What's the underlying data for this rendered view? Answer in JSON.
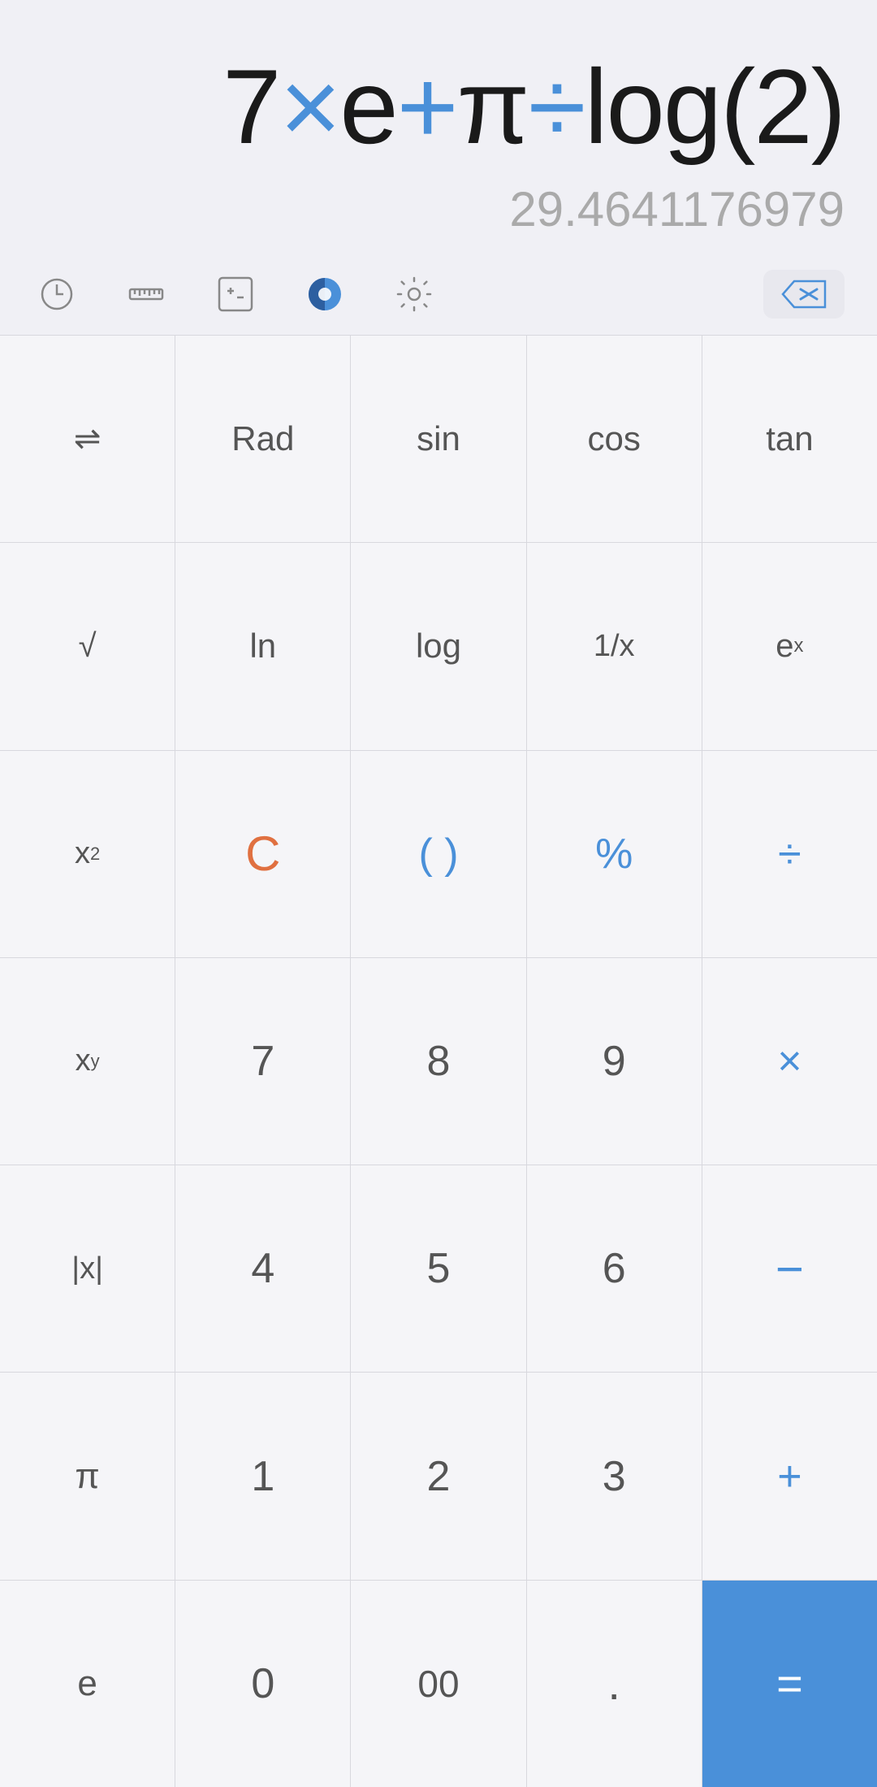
{
  "display": {
    "expression": {
      "parts": [
        {
          "text": "7",
          "style": "normal"
        },
        {
          "text": "×",
          "style": "blue"
        },
        {
          "text": "e",
          "style": "normal"
        },
        {
          "text": "+",
          "style": "blue"
        },
        {
          "text": "π",
          "style": "normal"
        },
        {
          "text": "÷",
          "style": "blue"
        },
        {
          "text": "log(2)",
          "style": "normal"
        }
      ],
      "full": "7×e+π÷log(2)"
    },
    "result": "29.4641176979"
  },
  "toolbar": {
    "history_label": "history",
    "ruler_label": "ruler",
    "plusminus_label": "plusminus",
    "theme_label": "theme",
    "settings_label": "settings",
    "backspace_label": "⌫"
  },
  "keypad": {
    "rows": [
      [
        {
          "label": "⇌",
          "style": "normal",
          "name": "swap"
        },
        {
          "label": "Rad",
          "style": "normal",
          "name": "rad"
        },
        {
          "label": "sin",
          "style": "normal",
          "name": "sin"
        },
        {
          "label": "cos",
          "style": "normal",
          "name": "cos"
        },
        {
          "label": "tan",
          "style": "normal",
          "name": "tan"
        }
      ],
      [
        {
          "label": "√",
          "style": "normal",
          "name": "sqrt"
        },
        {
          "label": "ln",
          "style": "normal",
          "name": "ln"
        },
        {
          "label": "log",
          "style": "normal",
          "name": "log"
        },
        {
          "label": "1/x",
          "style": "normal",
          "name": "reciprocal"
        },
        {
          "label": "eˣ",
          "style": "normal",
          "name": "exp"
        }
      ],
      [
        {
          "label": "x²",
          "style": "normal",
          "name": "square"
        },
        {
          "label": "C",
          "style": "orange",
          "name": "clear"
        },
        {
          "label": "( )",
          "style": "blue",
          "name": "parens"
        },
        {
          "label": "%",
          "style": "blue",
          "name": "percent"
        },
        {
          "label": "÷",
          "style": "blue",
          "name": "divide"
        }
      ],
      [
        {
          "label": "xʸ",
          "style": "normal",
          "name": "power"
        },
        {
          "label": "7",
          "style": "normal",
          "name": "seven"
        },
        {
          "label": "8",
          "style": "normal",
          "name": "eight"
        },
        {
          "label": "9",
          "style": "normal",
          "name": "nine"
        },
        {
          "label": "×",
          "style": "blue",
          "name": "multiply"
        }
      ],
      [
        {
          "label": "|x|",
          "style": "normal",
          "name": "abs"
        },
        {
          "label": "4",
          "style": "normal",
          "name": "four"
        },
        {
          "label": "5",
          "style": "normal",
          "name": "five"
        },
        {
          "label": "6",
          "style": "normal",
          "name": "six"
        },
        {
          "label": "−",
          "style": "blue",
          "name": "subtract"
        }
      ],
      [
        {
          "label": "π",
          "style": "normal",
          "name": "pi"
        },
        {
          "label": "1",
          "style": "normal",
          "name": "one"
        },
        {
          "label": "2",
          "style": "normal",
          "name": "two"
        },
        {
          "label": "3",
          "style": "normal",
          "name": "three"
        },
        {
          "label": "+",
          "style": "blue",
          "name": "add"
        }
      ],
      [
        {
          "label": "e",
          "style": "normal",
          "name": "euler"
        },
        {
          "label": "0",
          "style": "normal",
          "name": "zero"
        },
        {
          "label": "00",
          "style": "normal",
          "name": "double-zero"
        },
        {
          "label": ".",
          "style": "normal",
          "name": "decimal"
        },
        {
          "label": "=",
          "style": "blue-bg",
          "name": "equals"
        }
      ]
    ]
  }
}
